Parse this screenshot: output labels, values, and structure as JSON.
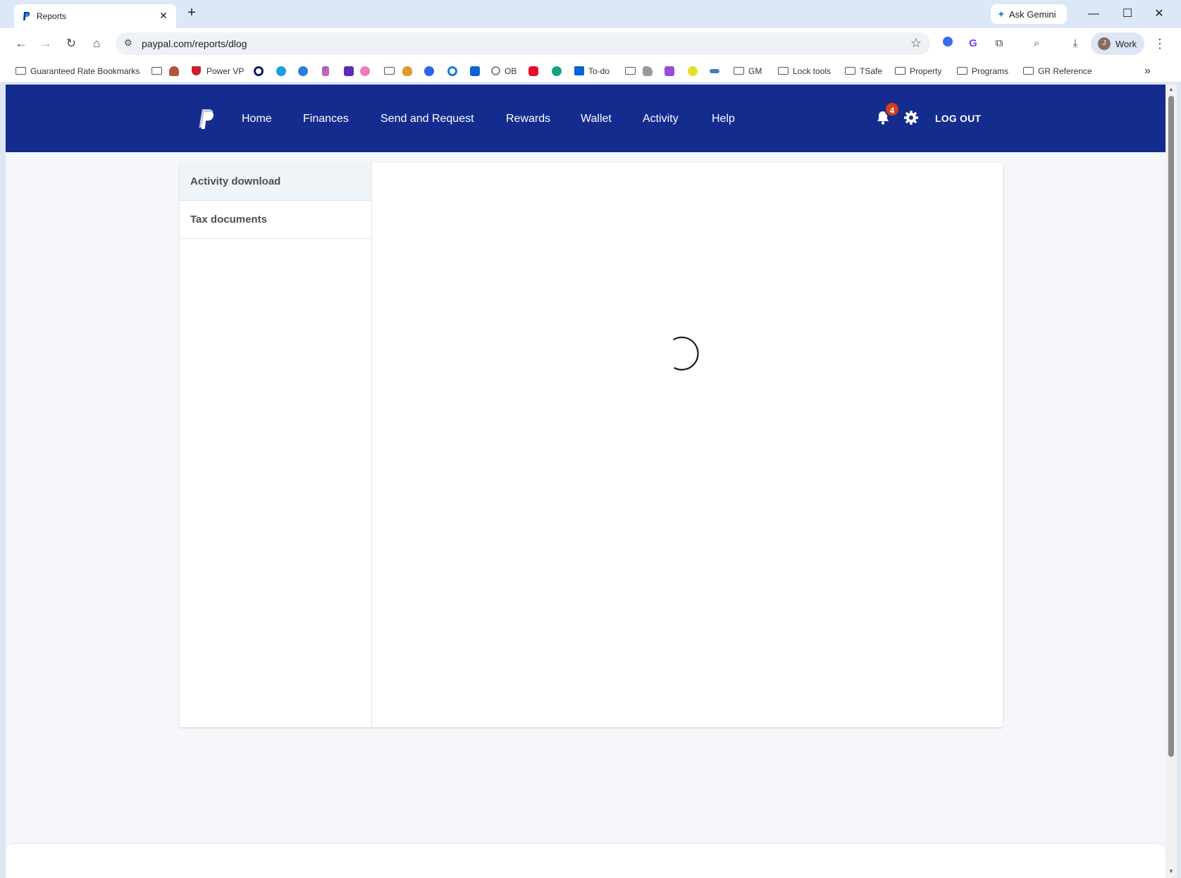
{
  "browser": {
    "tab_title": "Reports",
    "new_tab_label": "+",
    "close_tab_label": "✕",
    "ask_gemini_label": "Ask Gemini",
    "url": "paypal.com/reports/dlog",
    "profile_initial": "J",
    "profile_name": "Work",
    "window_controls": {
      "minimize": "—",
      "maximize": "☐",
      "close": "✕"
    }
  },
  "bookmarks": [
    {
      "label": "Guaranteed Rate Bookmarks",
      "icon": "managed-folder-icon"
    },
    {
      "label": "",
      "icon": "folder-icon"
    },
    {
      "label": "",
      "icon": "red-poop-icon"
    },
    {
      "label": "Power VP",
      "icon": "red-shield-icon"
    },
    {
      "label": "",
      "icon": "ring-icon"
    },
    {
      "label": "",
      "icon": "salesforce-cloud-icon"
    },
    {
      "label": "",
      "icon": "onedrive-cloud-icon"
    },
    {
      "label": "",
      "icon": "clickup-icon"
    },
    {
      "label": "",
      "icon": "list-icon"
    },
    {
      "label": "",
      "icon": "pink-bubble-icon"
    },
    {
      "label": "",
      "icon": "folder-icon"
    },
    {
      "label": "",
      "icon": "money-bag-icon"
    },
    {
      "label": "",
      "icon": "blue-circle-icon"
    },
    {
      "label": "",
      "icon": "target-icon"
    },
    {
      "label": "",
      "icon": "box-notify-icon"
    },
    {
      "label": "OB",
      "icon": "ob-icon"
    },
    {
      "label": "",
      "icon": "youtube-icon"
    },
    {
      "label": "",
      "icon": "grammarly-icon"
    },
    {
      "label": "To-do",
      "icon": "box-icon"
    },
    {
      "label": "",
      "icon": "folder-icon"
    },
    {
      "label": "",
      "icon": "hand-icon"
    },
    {
      "label": "",
      "icon": "hi-icon"
    },
    {
      "label": "",
      "icon": "quo-icon"
    },
    {
      "label": "",
      "icon": "bird-icon"
    },
    {
      "label": "GM",
      "icon": "folder-icon"
    },
    {
      "label": "Lock tools",
      "icon": "folder-icon"
    },
    {
      "label": "TSafe",
      "icon": "folder-icon"
    },
    {
      "label": "Property",
      "icon": "folder-icon"
    },
    {
      "label": "Programs",
      "icon": "folder-icon"
    },
    {
      "label": "GR Reference",
      "icon": "folder-icon"
    }
  ],
  "bookmarks_overflow": "»",
  "paypal": {
    "nav": [
      "Home",
      "Finances",
      "Send and Request",
      "Rewards",
      "Wallet",
      "Activity",
      "Help"
    ],
    "notification_count": "4",
    "logout_label": "LOG OUT",
    "sidebar": [
      {
        "label": "Activity download",
        "active": true
      },
      {
        "label": "Tax documents",
        "active": false
      }
    ],
    "brand_color": "#142c8e",
    "badge_color": "#d63b19"
  }
}
